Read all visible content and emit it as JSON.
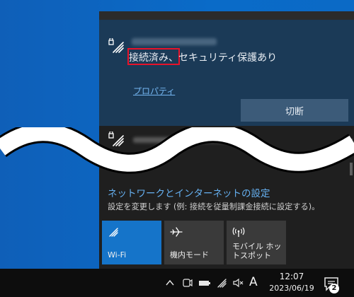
{
  "connected_network": {
    "status": "接続済み、セキュリティ保護あり",
    "properties_link": "プロパティ",
    "disconnect_button": "切断",
    "icon": "wifi-secured-icon"
  },
  "network_settings": {
    "title": "ネットワークとインターネットの設定",
    "description": "設定を変更します (例: 接続を従量制課金接続に設定する)。"
  },
  "quick_actions": [
    {
      "label": "Wi-Fi",
      "icon": "wifi-icon",
      "active": true
    },
    {
      "label": "機内モード",
      "icon": "airplane-icon",
      "active": false
    },
    {
      "label": "モバイル ホットスポット",
      "icon": "hotspot-icon",
      "active": false
    }
  ],
  "taskbar": {
    "time": "12:07",
    "date": "2023/06/19",
    "ime_mode": "A",
    "notification_count": "2"
  },
  "colors": {
    "accent": "#1574c9",
    "selected_network_bg": "#1b3a57",
    "highlight_box": "#e8132a",
    "link": "#74b6f2"
  }
}
